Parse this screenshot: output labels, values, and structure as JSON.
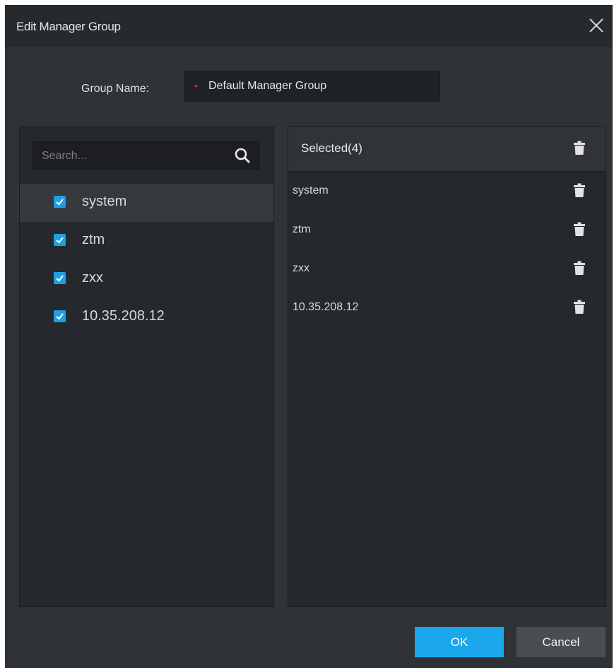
{
  "dialog": {
    "title": "Edit Manager Group",
    "close_icon": "close-icon"
  },
  "group": {
    "label": "Group Name:",
    "required_marker": "•",
    "value": "Default Manager Group"
  },
  "search": {
    "placeholder": "Search...",
    "icon": "search-icon"
  },
  "users": [
    {
      "label": "system",
      "checked": true
    },
    {
      "label": "ztm",
      "checked": true
    },
    {
      "label": "zxx",
      "checked": true
    },
    {
      "label": "10.35.208.12",
      "checked": true
    }
  ],
  "selected": {
    "title": "Selected(4)",
    "items": [
      {
        "label": "system"
      },
      {
        "label": "ztm"
      },
      {
        "label": "zxx"
      },
      {
        "label": "10.35.208.12"
      }
    ]
  },
  "buttons": {
    "ok": "OK",
    "cancel": "Cancel"
  },
  "colors": {
    "accent": "#1aa7ec",
    "required": "#e0281f",
    "background": "#2f3337"
  }
}
